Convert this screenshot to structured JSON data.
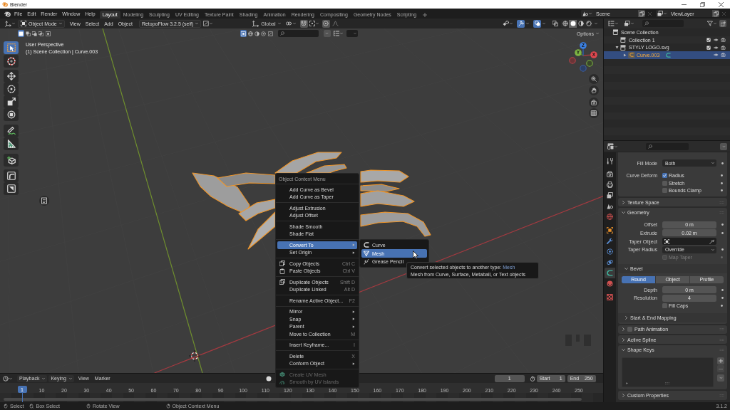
{
  "window": {
    "title": "Blender"
  },
  "top_bar": {
    "menus": [
      "File",
      "Edit",
      "Render",
      "Window",
      "Help"
    ],
    "workspaces": [
      {
        "label": "Layout",
        "selected": true
      },
      {
        "label": "Modeling",
        "selected": false
      },
      {
        "label": "Sculpting",
        "selected": false
      },
      {
        "label": "UV Editing",
        "selected": false
      },
      {
        "label": "Texture Paint",
        "selected": false
      },
      {
        "label": "Shading",
        "selected": false
      },
      {
        "label": "Animation",
        "selected": false
      },
      {
        "label": "Rendering",
        "selected": false
      },
      {
        "label": "Compositing",
        "selected": false
      },
      {
        "label": "Geometry Nodes",
        "selected": false
      },
      {
        "label": "Scripting",
        "selected": false
      }
    ],
    "scene": "Scene",
    "view_layer": "ViewLayer"
  },
  "viewport_header": {
    "mode": "Object Mode",
    "menus": [
      "View",
      "Select",
      "Add",
      "Object"
    ],
    "addon_menu": "RetopoFlow 3.2.5 (self)",
    "orientation": "Global",
    "gizmos_on": true,
    "overlays_on": true,
    "xray_on": false,
    "shading": [
      {
        "selected": false
      },
      {
        "selected": true
      },
      {
        "selected": false
      },
      {
        "selected": false
      }
    ]
  },
  "tool_header": {
    "select_modes": [
      {
        "selected": true
      },
      {
        "selected": false
      },
      {
        "selected": false
      },
      {
        "selected": false
      },
      {
        "selected": false
      }
    ],
    "toggle_group": [
      {
        "selected": true
      },
      {
        "selected": false
      },
      {
        "selected": false
      },
      {
        "selected": false
      },
      {
        "selected": false
      }
    ],
    "options": "Options"
  },
  "toolbar": [
    {
      "selected": true
    },
    {
      "selected": false
    },
    {
      "selected": false
    },
    {
      "selected": false
    },
    {
      "selected": false
    },
    {
      "selected": false
    },
    {
      "selected": false
    },
    {
      "selected": false
    },
    {
      "selected": false
    },
    {
      "selected": false
    },
    {
      "selected": false
    }
  ],
  "viewport": {
    "view_name": "User Perspective",
    "info": "(1) Scene Collection | Curve.003",
    "gizmo_axes": [
      "X",
      "Y",
      "Z"
    ]
  },
  "context_menu": {
    "title": "Object Context Menu",
    "sections": [
      [
        {
          "label": "Add Curve as Bevel",
          "kind": "action",
          "selected": false,
          "disabled": false
        },
        {
          "label": "Add Curve as Taper",
          "kind": "action",
          "selected": false,
          "disabled": false
        }
      ],
      [
        {
          "label": "Adjust Extrusion",
          "kind": "action",
          "selected": false,
          "disabled": false
        },
        {
          "label": "Adjust Offset",
          "kind": "action",
          "selected": false,
          "disabled": false
        }
      ],
      [
        {
          "label": "Shade Smooth",
          "kind": "action",
          "selected": false,
          "disabled": false
        },
        {
          "label": "Shade Flat",
          "kind": "action",
          "selected": false,
          "disabled": false
        }
      ],
      [
        {
          "label": "Convert To",
          "kind": "submenu",
          "selected": true,
          "disabled": false
        },
        {
          "label": "Set Origin",
          "kind": "submenu",
          "selected": false,
          "disabled": false
        }
      ],
      [
        {
          "label": "Copy Objects",
          "kind": "action",
          "shortcut": "Ctrl C",
          "selected": false,
          "disabled": false
        },
        {
          "label": "Paste Objects",
          "kind": "action",
          "shortcut": "Ctrl V",
          "selected": false,
          "disabled": false
        }
      ],
      [
        {
          "label": "Duplicate Objects",
          "kind": "action",
          "shortcut": "Shift D",
          "selected": false,
          "disabled": false
        },
        {
          "label": "Duplicate Linked",
          "kind": "action",
          "shortcut": "Alt D",
          "selected": false,
          "disabled": false
        }
      ],
      [
        {
          "label": "Rename Active Object...",
          "kind": "action",
          "shortcut": "F2",
          "selected": false,
          "disabled": false
        }
      ],
      [
        {
          "label": "Mirror",
          "kind": "submenu",
          "selected": false,
          "disabled": false
        },
        {
          "label": "Snap",
          "kind": "submenu",
          "selected": false,
          "disabled": false
        },
        {
          "label": "Parent",
          "kind": "submenu",
          "selected": false,
          "disabled": false
        },
        {
          "label": "Move to Collection",
          "kind": "action",
          "shortcut": "M",
          "selected": false,
          "disabled": false
        }
      ],
      [
        {
          "label": "Insert Keyframe...",
          "kind": "action",
          "shortcut": "I",
          "selected": false,
          "disabled": false
        }
      ],
      [
        {
          "label": "Delete",
          "kind": "action",
          "shortcut": "X",
          "selected": false,
          "disabled": false
        },
        {
          "label": "Conform Object",
          "kind": "submenu",
          "selected": false,
          "disabled": false
        }
      ],
      [
        {
          "label": "Create UV Mesh",
          "kind": "action",
          "selected": false,
          "disabled": true
        },
        {
          "label": "Smooth by UV Islands",
          "kind": "action",
          "selected": false,
          "disabled": true
        }
      ]
    ],
    "submenu": {
      "items": [
        {
          "label": "Curve",
          "selected": false
        },
        {
          "label": "Mesh",
          "selected": true
        },
        {
          "label": "Grease Pencil",
          "selected": false
        }
      ]
    },
    "tooltip": {
      "text": "Convert selected objects to another type:",
      "value": "Mesh",
      "description": "Mesh from Curve, Surface, Metaball, or Text objects"
    }
  },
  "outliner": {
    "tree": [
      {
        "kind": "scene_collection",
        "label": "Scene Collection",
        "selected": false,
        "children": [
          {
            "kind": "collection",
            "label": "Collection 1",
            "selected": false,
            "checked": true
          },
          {
            "kind": "collection",
            "label": "STYLY LOGO.svg",
            "selected": false,
            "checked": true,
            "expanded": true,
            "children": [
              {
                "kind": "object",
                "label": "Curve.003",
                "selected": true,
                "expanded": false
              }
            ]
          }
        ]
      }
    ]
  },
  "properties": {
    "tabs": [
      {
        "selected": false
      },
      {
        "selected": false
      },
      {
        "selected": false
      },
      {
        "selected": false
      },
      {
        "selected": false
      },
      {
        "selected": false
      },
      {
        "selected": false
      },
      {
        "selected": false
      },
      {
        "selected": false
      },
      {
        "selected": false
      },
      {
        "selected": true
      },
      {
        "selected": false
      },
      {
        "selected": false
      }
    ],
    "panels": [
      {
        "kind": "continued",
        "rows": [
          {
            "kind": "dropdown",
            "label": "Fill Mode",
            "value": "Both"
          },
          {
            "kind": "checkbox",
            "label": "Curve Deform",
            "text": "Radius",
            "checked": true,
            "disabled": false
          },
          {
            "kind": "checkbox",
            "text": "Stretch",
            "checked": false,
            "disabled": false
          },
          {
            "kind": "checkbox",
            "text": "Bounds Clamp",
            "checked": false,
            "disabled": false
          }
        ]
      },
      {
        "kind": "panel",
        "title": "Texture Space",
        "expanded": false
      },
      {
        "kind": "panel",
        "title": "Geometry",
        "expanded": true,
        "rows": [
          {
            "kind": "number",
            "label": "Offset",
            "value": "0 m"
          },
          {
            "kind": "number",
            "label": "Extrude",
            "value": "0.02 m"
          },
          {
            "kind": "object_field",
            "label": "Taper Object"
          },
          {
            "kind": "dropdown",
            "label": "Taper Radius",
            "value": "Override"
          },
          {
            "kind": "checkbox",
            "text": "Map Taper",
            "checked": false,
            "disabled": true
          },
          {
            "kind": "subpanel",
            "title": "Bevel",
            "expanded": true,
            "rows": [
              {
                "kind": "segmented",
                "options": [
                  {
                    "label": "Round",
                    "selected": true
                  },
                  {
                    "label": "Object",
                    "selected": false
                  },
                  {
                    "label": "Profile",
                    "selected": false
                  }
                ]
              },
              {
                "kind": "number",
                "label": "Depth",
                "value": "0 m"
              },
              {
                "kind": "number",
                "label": "Resolution",
                "value": "4"
              },
              {
                "kind": "checkbox",
                "text": "Fill Caps",
                "checked": false,
                "disabled": false
              }
            ]
          },
          {
            "kind": "subpanel",
            "title": "Start & End Mapping",
            "expanded": false
          }
        ]
      },
      {
        "kind": "check_panel",
        "title": "Path Animation",
        "expanded": false,
        "checked": false
      },
      {
        "kind": "panel",
        "title": "Active Spline",
        "expanded": false
      },
      {
        "kind": "panel",
        "title": "Shape Keys",
        "expanded": true,
        "rows": [
          {
            "kind": "list"
          }
        ]
      },
      {
        "kind": "panel",
        "title": "Custom Properties",
        "expanded": false
      }
    ]
  },
  "timeline": {
    "menus": [
      "Playback",
      "Keying",
      "View",
      "Marker"
    ],
    "current_frame": "1",
    "start": {
      "label": "Start",
      "value": "1"
    },
    "end": {
      "label": "End",
      "value": "250"
    },
    "ruler": {
      "current": "1",
      "ticks": [
        "10",
        "20",
        "30",
        "40",
        "50",
        "60",
        "70",
        "80",
        "90",
        "100",
        "110",
        "120",
        "130",
        "140",
        "150",
        "160",
        "170",
        "180",
        "190",
        "200",
        "210",
        "220",
        "230",
        "240",
        "250"
      ]
    }
  },
  "status_bar": {
    "hints": [
      "Select",
      "Box Select",
      "Rotate View",
      "Object Context Menu"
    ],
    "version": "3.1.2"
  }
}
